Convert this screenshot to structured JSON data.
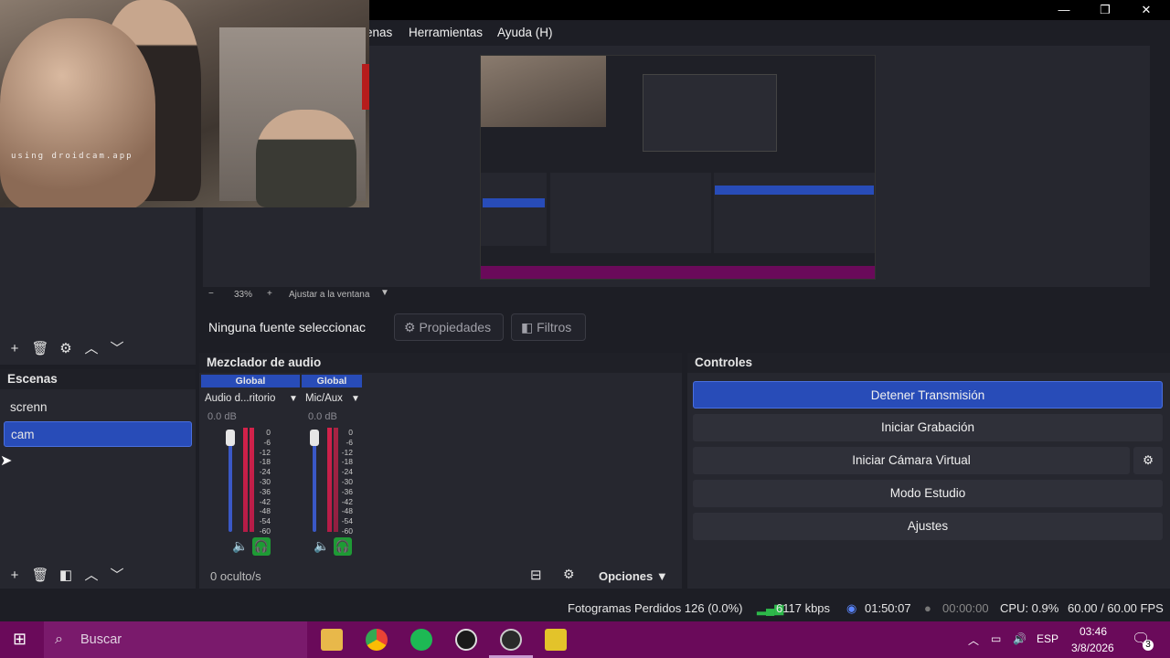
{
  "window": {
    "menu": [
      "enas",
      "Herramientas",
      "Ayuda (H)"
    ],
    "controls": [
      "—",
      "❐",
      "✕"
    ]
  },
  "webcam": {
    "watermark": "using droidcam.app"
  },
  "preview_toolbar": {
    "zoom_minus": "−",
    "zoom": "33%",
    "zoom_plus": "+",
    "fit": "Ajustar a la ventana"
  },
  "source_bar": {
    "none_selected": "Ninguna fuente seleccionac",
    "properties": "Propiedades",
    "filters": "Filtros"
  },
  "scenes": {
    "title": "Escenas",
    "items": [
      {
        "label": "screnn",
        "active": false
      },
      {
        "label": "cam",
        "active": true
      }
    ]
  },
  "mixer": {
    "title": "Mezclador de audio",
    "channels": [
      {
        "group": "Global",
        "name": "Audio d...ritorio",
        "db": "0.0 dB"
      },
      {
        "group": "Global",
        "name": "Mic/Aux",
        "db": "0.0 dB"
      }
    ],
    "scale": [
      "0",
      "-6",
      "-12",
      "-18",
      "-24",
      "-30",
      "-36",
      "-42",
      "-48",
      "-54",
      "-60"
    ],
    "footer_hidden": "0 oculto/s",
    "footer_options": "Opciones"
  },
  "controls": {
    "title": "Controles",
    "stop_stream": "Detener Transmisión",
    "start_recording": "Iniciar Grabación",
    "start_virtual_cam": "Iniciar Cámara Virtual",
    "studio_mode": "Modo Estudio",
    "settings": "Ajustes"
  },
  "status": {
    "dropped": "Fotogramas Perdidos 126 (0.0%)",
    "bitrate": "6117 kbps",
    "stream_time": "01:50:07",
    "rec_time": "00:00:00",
    "cpu": "CPU: 0.9%",
    "fps": "60.00 / 60.00 FPS"
  },
  "taskbar": {
    "search": "Buscar",
    "lang": "ESP",
    "time": "03:46",
    "date": "3/8/2026",
    "notifications": "3"
  },
  "colors": {
    "accent": "#284cb8",
    "meter": "#d3224a",
    "monitor": "#1e9a35",
    "taskbar": "#6a0a5a"
  }
}
